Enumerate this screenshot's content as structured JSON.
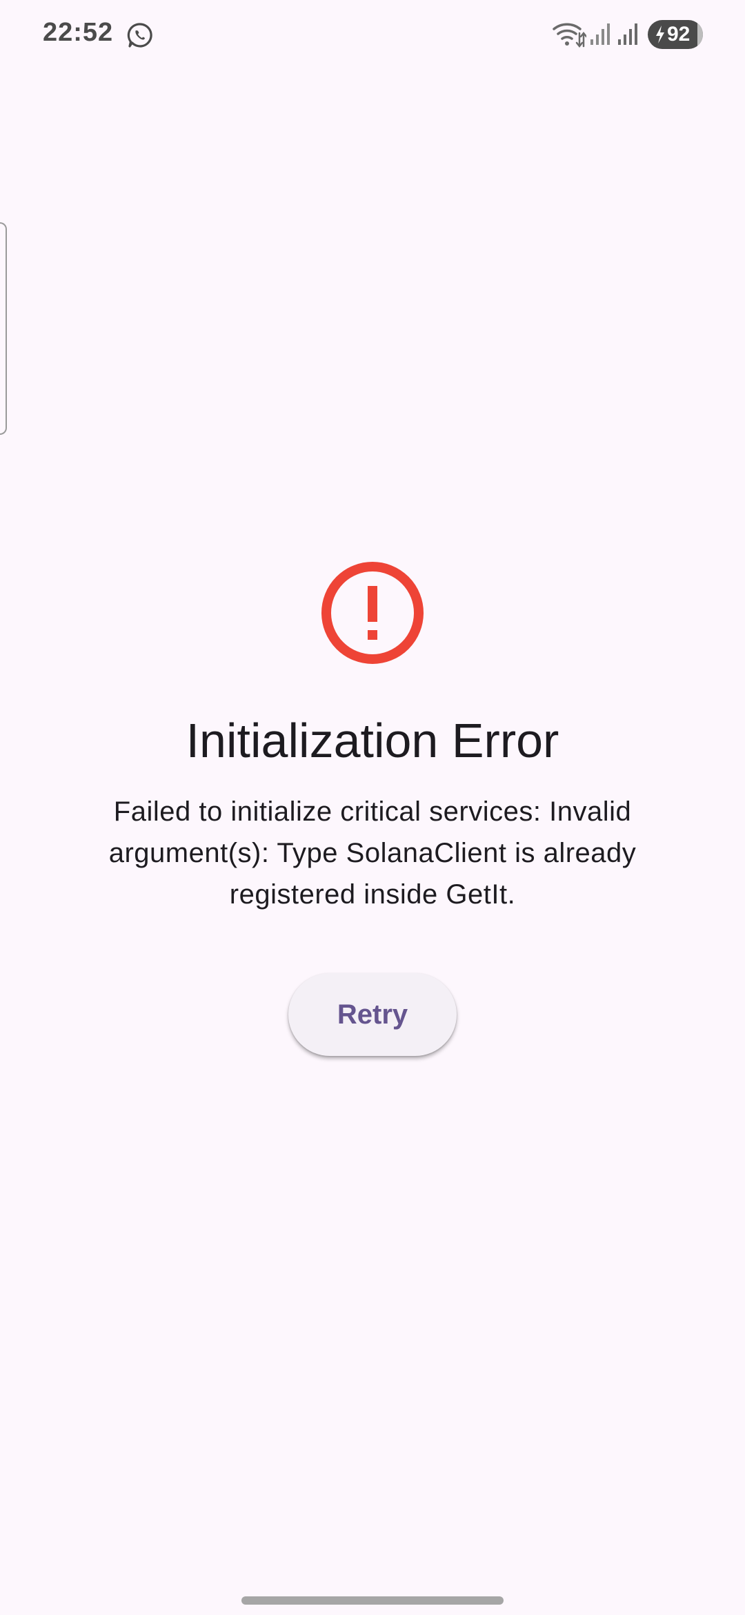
{
  "status_bar": {
    "time": "22:52",
    "battery_level": "92",
    "icons": [
      "whatsapp-icon",
      "wifi-icon",
      "signal-icon",
      "signal-icon",
      "battery-charging-icon"
    ]
  },
  "error": {
    "icon": "error-circle-icon",
    "icon_color": "#ee4436",
    "title": "Initialization Error",
    "message": "Failed to initialize critical services: Invalid argument(s): Type SolanaClient is already registered inside GetIt."
  },
  "actions": {
    "retry_label": "Retry",
    "accent_color": "#65558f"
  },
  "colors": {
    "background": "#fdf7fd",
    "text": "#1d1b20"
  }
}
